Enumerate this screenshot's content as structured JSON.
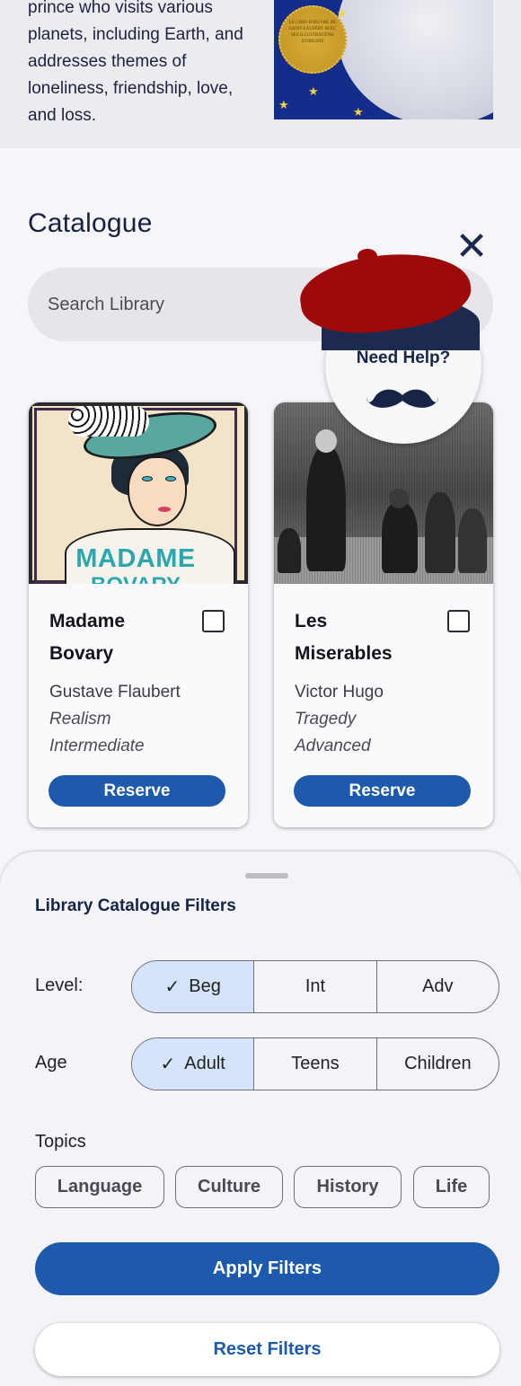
{
  "intro": {
    "description": "prince who visits various planets, including Earth, and addresses themes of loneliness, friendship, love, and loss.",
    "cover_seal_text": "LE CHEF-D'ŒUVRE DE SAINT-EXUPÉRY AVEC SES ILLUSTRATIONS D'ORIGINE"
  },
  "catalogue": {
    "title": "Catalogue",
    "search_placeholder": "Search Library",
    "books": [
      {
        "title": "Madame Bovary",
        "author": "Gustave Flaubert",
        "genre": "Realism",
        "level": "Intermediate",
        "reserve_label": "Reserve",
        "cover_text": "MADAME",
        "cover_text2": "BOVARY",
        "selected": false
      },
      {
        "title": "Les Miserables",
        "author": "Victor Hugo",
        "genre": "Tragedy",
        "level": "Advanced",
        "reserve_label": "Reserve",
        "selected": false
      }
    ]
  },
  "help": {
    "label": "Need Help?",
    "close_glyph": "✕"
  },
  "filters": {
    "title": "Library Catalogue Filters",
    "level": {
      "label": "Level:",
      "options": [
        "Beg",
        "Int",
        "Adv"
      ],
      "selected": "Beg"
    },
    "age": {
      "label": "Age",
      "options": [
        "Adult",
        "Teens",
        "Children"
      ],
      "selected": "Adult"
    },
    "topics": {
      "label": "Topics",
      "options": [
        "Language",
        "Culture",
        "History",
        "Life"
      ]
    },
    "apply_label": "Apply Filters",
    "reset_label": "Reset Filters"
  },
  "colors": {
    "accent": "#1e5aab",
    "selected_segment": "#d6e4fb",
    "beret": "#9c0a0a",
    "navy": "#162545"
  }
}
